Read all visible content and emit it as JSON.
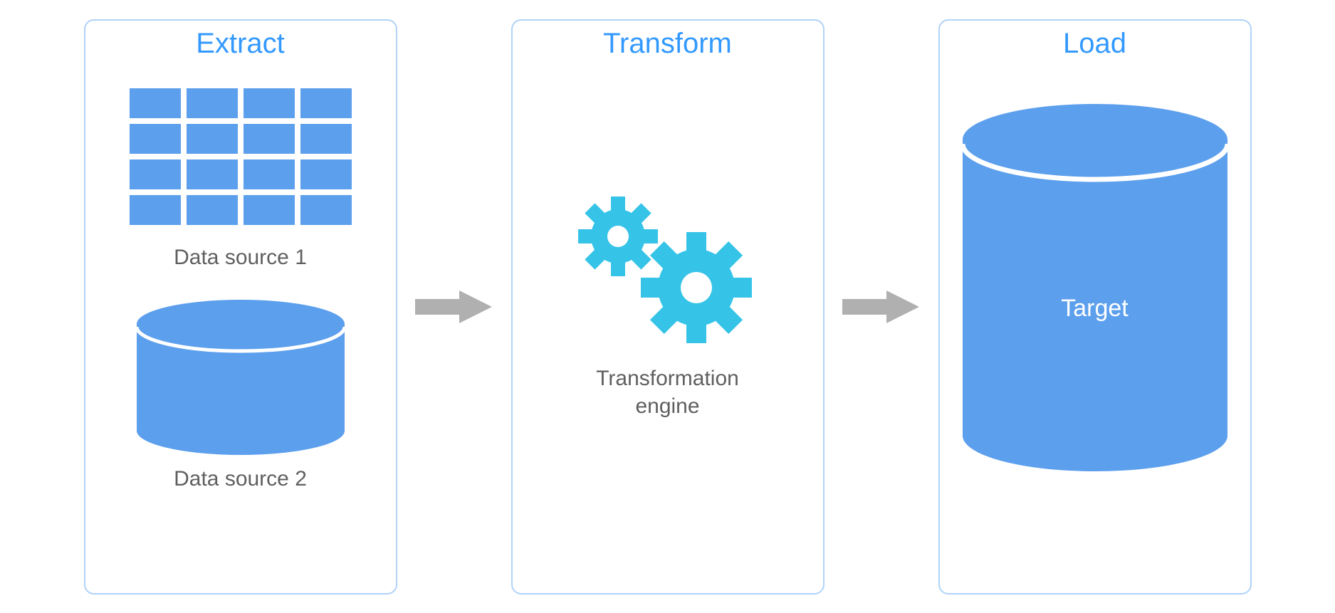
{
  "stages": {
    "extract": {
      "title": "Extract",
      "source1_label": "Data source 1",
      "source2_label": "Data source 2"
    },
    "transform": {
      "title": "Transform",
      "engine_label_line1": "Transformation",
      "engine_label_line2": "engine"
    },
    "load": {
      "title": "Load",
      "target_label": "Target"
    }
  },
  "colors": {
    "border": "#B0D3F7",
    "title": "#3399FF",
    "label": "#5F5F5F",
    "cell": "#5C9FED",
    "cylinder": "#5C9FED",
    "gear": "#35C3E8",
    "arrow": "#B0B0B0"
  }
}
